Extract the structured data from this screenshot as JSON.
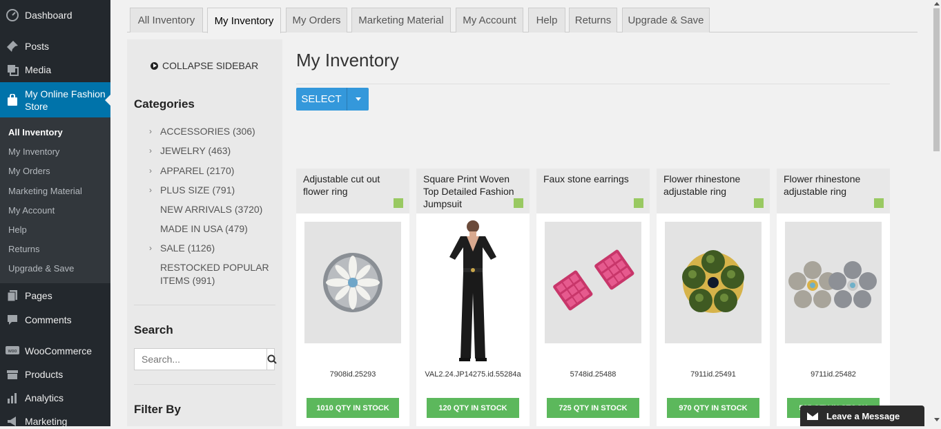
{
  "wp_menu": {
    "dashboard": "Dashboard",
    "posts": "Posts",
    "media": "Media",
    "store": "My Online Fashion Store",
    "submenu": [
      "All Inventory",
      "My Inventory",
      "My Orders",
      "Marketing Material",
      "My Account",
      "Help",
      "Returns",
      "Upgrade & Save"
    ],
    "pages": "Pages",
    "comments": "Comments",
    "woocommerce": "WooCommerce",
    "products": "Products",
    "analytics": "Analytics",
    "marketing": "Marketing"
  },
  "tabs": [
    "All Inventory",
    "My Inventory",
    "My Orders",
    "Marketing Material",
    "My Account",
    "Help",
    "Returns",
    "Upgrade & Save"
  ],
  "sidebar": {
    "collapse": "COLLAPSE SIDEBAR",
    "categories_title": "Categories",
    "categories": [
      "ACCESSORIES (306)",
      "JEWELRY (463)",
      "APPAREL (2170)",
      "PLUS SIZE (791)",
      "NEW ARRIVALS (3720)",
      "MADE IN USA (479)",
      "SALE (1126)",
      "RESTOCKED POPULAR ITEMS (991)"
    ],
    "search_title": "Search",
    "search_placeholder": "Search...",
    "filter_title": "Filter By"
  },
  "main": {
    "title": "My Inventory",
    "select_label": "SELECT"
  },
  "products": [
    {
      "name": "Adjustable cut out flower ring",
      "sku": "7908id.25293",
      "stock": "1010 QTY IN STOCK"
    },
    {
      "name": "Square Print Woven Top Detailed Fashion Jumpsuit",
      "sku": "VAL2.24.JP14275.id.55284a",
      "stock": "120 QTY IN STOCK"
    },
    {
      "name": "Faux stone earrings",
      "sku": "5748id.25488",
      "stock": "725 QTY IN STOCK"
    },
    {
      "name": "Flower rhinestone adjustable ring",
      "sku": "7911id.25491",
      "stock": "970 QTY IN STOCK"
    },
    {
      "name": "Flower rhinestone adjustable ring",
      "sku": "9711id.25482",
      "stock": "535 QTY IN STOCK"
    }
  ],
  "chat": {
    "label": "Leave a Message"
  },
  "colors": {
    "wp_dark": "#23282d",
    "wp_active": "#0073aa",
    "stock_green": "#5cb85c",
    "select_blue": "#3498db"
  }
}
